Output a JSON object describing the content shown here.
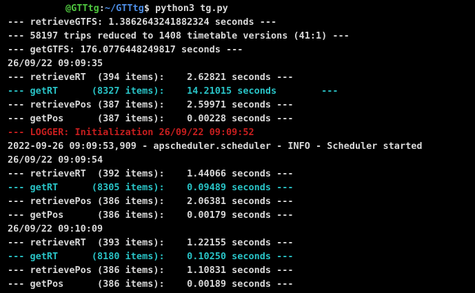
{
  "prompt": {
    "user_host": "@GTTtg",
    "separator": ":",
    "path": "~/GTTtg",
    "symbol": "$",
    "command": " python3 tg.py"
  },
  "colors": {
    "default": "#d9d9d9",
    "cyan": "#29c3c6",
    "red": "#c81e1e",
    "green": "#4fc63f",
    "blue": "#4e8fe8",
    "background": "#000000"
  },
  "lines": [
    {
      "text": "--- retrieveGTFS: 1.3862643241882324 seconds ---",
      "color": "default"
    },
    {
      "text": "--- 58197 trips reduced to 1408 timetable versions (41:1) ---",
      "color": "default"
    },
    {
      "text": "--- getGTFS: 176.0776448249817 seconds ---",
      "color": "default"
    },
    {
      "text": "26/09/22 09:09:35",
      "color": "default"
    },
    {
      "text": "--- retrieveRT  (394 items):    2.62821 seconds ---",
      "color": "default"
    },
    {
      "text": "--- getRT      (8327 items):    14.21015 seconds        ---",
      "color": "cyan"
    },
    {
      "text": "--- retrievePos (387 items):    2.59971 seconds ---",
      "color": "default"
    },
    {
      "text": "--- getPos      (387 items):    0.00228 seconds ---",
      "color": "default"
    },
    {
      "text": "--- LOGGER: Initialization 26/09/22 09:09:52",
      "color": "red"
    },
    {
      "text": "2022-09-26 09:09:53,909 - apscheduler.scheduler - INFO - Scheduler started",
      "color": "default"
    },
    {
      "text": "26/09/22 09:09:54",
      "color": "default"
    },
    {
      "text": "--- retrieveRT  (392 items):    1.44066 seconds ---",
      "color": "default"
    },
    {
      "text": "--- getRT      (8305 items):    0.09489 seconds ---",
      "color": "cyan"
    },
    {
      "text": "--- retrievePos (386 items):    2.06381 seconds ---",
      "color": "default"
    },
    {
      "text": "--- getPos      (386 items):    0.00179 seconds ---",
      "color": "default"
    },
    {
      "text": "26/09/22 09:10:09",
      "color": "default"
    },
    {
      "text": "--- retrieveRT  (393 items):    1.22155 seconds ---",
      "color": "default"
    },
    {
      "text": "--- getRT      (8180 items):    0.10250 seconds ---",
      "color": "cyan"
    },
    {
      "text": "--- retrievePos (386 items):    1.10831 seconds ---",
      "color": "default"
    },
    {
      "text": "--- getPos      (386 items):    0.00189 seconds ---",
      "color": "default"
    }
  ]
}
